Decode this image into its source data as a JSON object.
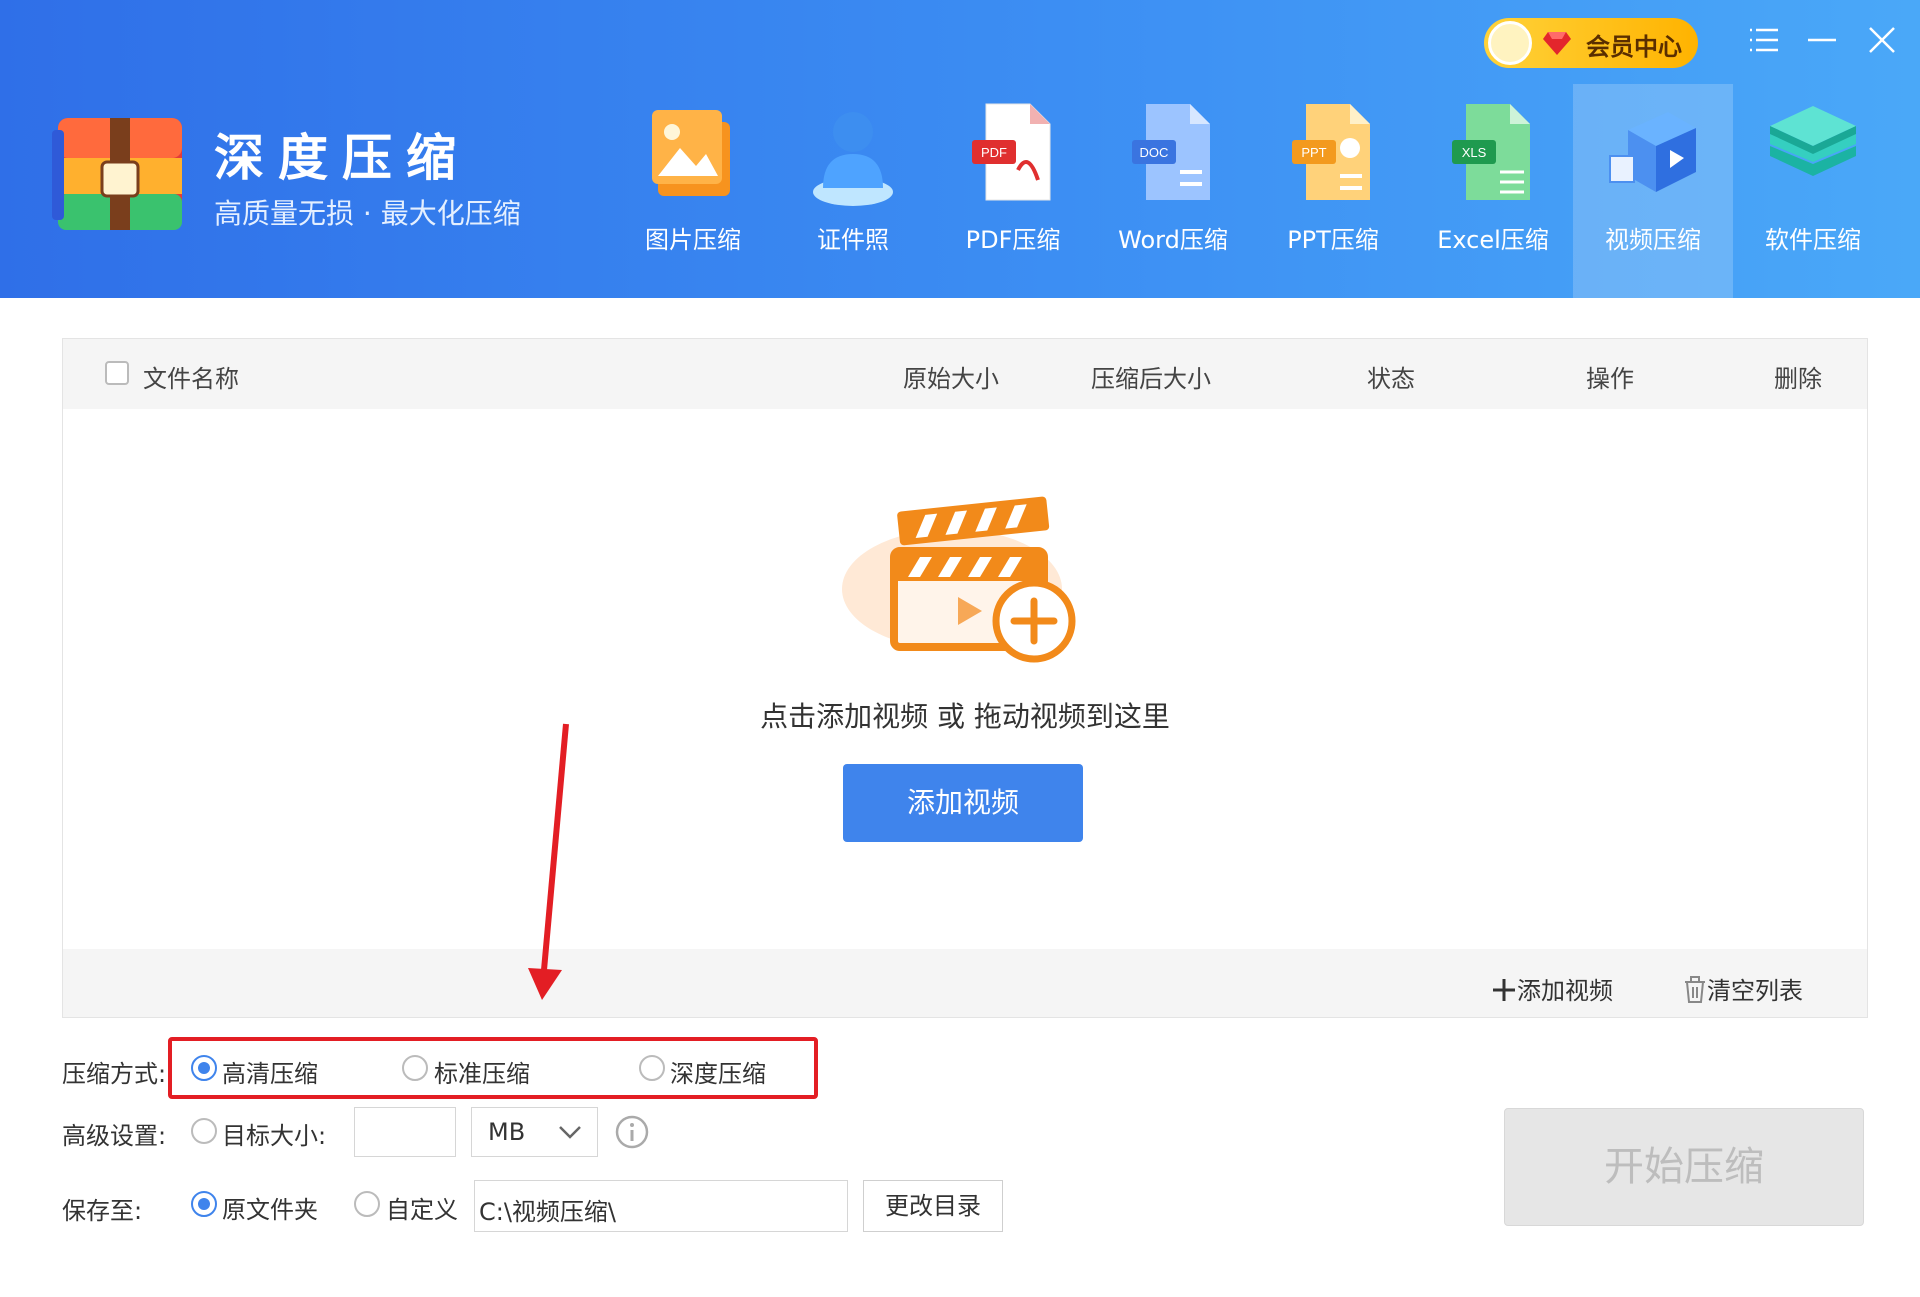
{
  "app": {
    "title": "深度压缩",
    "subtitle": "高质量无损 · 最大化压缩",
    "vip_label": "会员中心"
  },
  "toolbar": {
    "items": [
      {
        "label": "图片压缩",
        "icon": "image-icon"
      },
      {
        "label": "证件照",
        "icon": "person-icon"
      },
      {
        "label": "PDF压缩",
        "icon": "pdf-file-icon"
      },
      {
        "label": "Word压缩",
        "icon": "doc-file-icon"
      },
      {
        "label": "PPT压缩",
        "icon": "ppt-file-icon"
      },
      {
        "label": "Excel压缩",
        "icon": "xls-file-icon"
      },
      {
        "label": "视频压缩",
        "icon": "video-icon",
        "active": true
      },
      {
        "label": "软件压缩",
        "icon": "layers-icon"
      }
    ],
    "file_badges": {
      "pdf": "PDF",
      "doc": "DOC",
      "ppt": "PPT",
      "xls": "XLS"
    }
  },
  "table": {
    "columns": [
      "文件名称",
      "原始大小",
      "压缩后大小",
      "状态",
      "操作",
      "删除"
    ]
  },
  "empty": {
    "hint": "点击添加视频 或 拖动视频到这里",
    "button": "添加视频"
  },
  "panel_footer": {
    "add": "添加视频",
    "clear": "清空列表"
  },
  "options": {
    "mode_label": "压缩方式:",
    "modes": [
      "高清压缩",
      "标准压缩",
      "深度压缩"
    ],
    "selected_mode": "高清压缩",
    "advanced_label": "高级设置:",
    "target_size_label": "目标大小:",
    "unit": "MB",
    "save_label": "保存至:",
    "save_original": "原文件夹",
    "save_custom": "自定义",
    "save_path": "C:\\视频压缩\\",
    "change_dir": "更改目录"
  },
  "start_button": "开始压缩",
  "colors": {
    "accent": "#3f84ec",
    "highlight_box": "#e31e24",
    "vip_gold": "#ffc21a"
  }
}
